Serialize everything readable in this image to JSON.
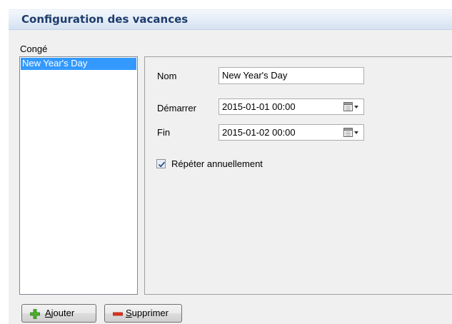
{
  "header": {
    "title": "Configuration des vacances"
  },
  "holiday_list": {
    "label": "Congé",
    "items": [
      {
        "label": "New Year's Day",
        "selected": true
      }
    ]
  },
  "details": {
    "name_label": "Nom",
    "name_value": "New Year's Day",
    "start_label": "Démarrer",
    "start_value": "2015-01-01  00:00",
    "end_label": "Fin",
    "end_value": "2015-01-02  00:00",
    "repeat_label": "Répéter annuellement",
    "repeat_checked": true
  },
  "buttons": {
    "add": {
      "mnemonic": "A",
      "rest": "jouter"
    },
    "remove": {
      "mnemonic": "S",
      "rest": "upprimer"
    }
  },
  "icons": {
    "add": "plus-icon",
    "remove": "minus-icon",
    "calendar": "calendar-icon",
    "dropdown": "chevron-down-icon",
    "check": "checkmark-icon"
  },
  "colors": {
    "header_title": "#1e3d6b",
    "selection": "#3399ff",
    "add_icon": "#4caf2a",
    "remove_icon": "#e0331f"
  }
}
